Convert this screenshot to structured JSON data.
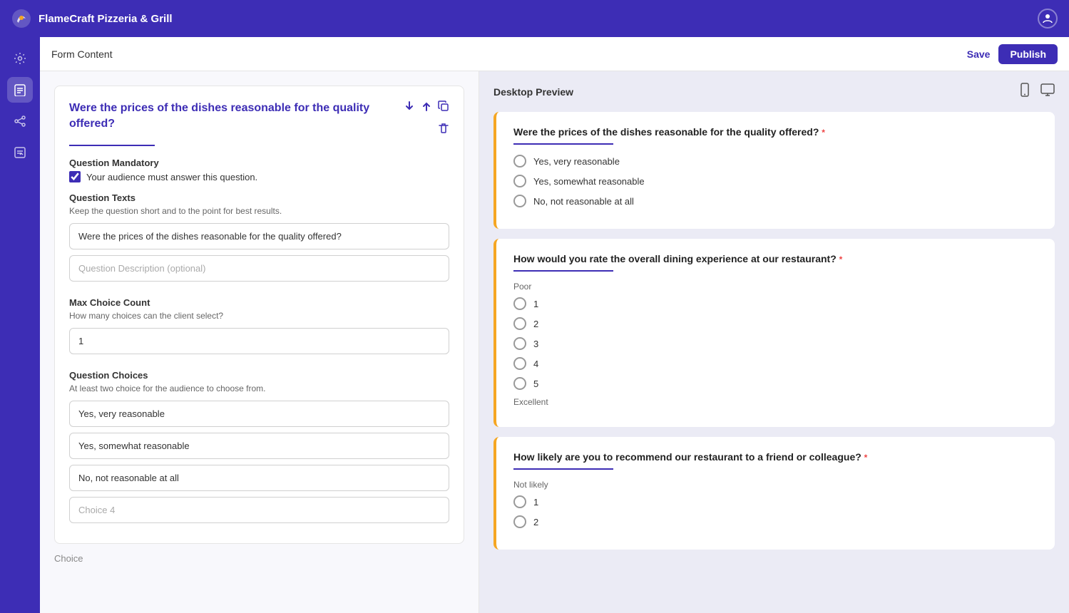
{
  "app": {
    "title": "FlameCraft Pizzeria & Grill"
  },
  "topnav": {
    "title": "FlameCraft Pizzeria & Grill",
    "save_label": "Save",
    "publish_label": "Publish"
  },
  "form_header": {
    "title": "Form Content"
  },
  "preview_header": {
    "title": "Desktop Preview"
  },
  "question": {
    "title": "Were the prices of the dishes reasonable for the quality offered?",
    "mandatory_label": "Question Mandatory",
    "mandatory_desc": "Your audience must answer this question.",
    "mandatory_checked": true,
    "texts_label": "Question Texts",
    "texts_desc": "Keep the question short and to the point for best results.",
    "question_text": "Were the prices of the dishes reasonable for the quality offered?",
    "question_desc_placeholder": "Question Description (optional)",
    "max_choice_label": "Max Choice Count",
    "max_choice_desc": "How many choices can the client select?",
    "max_choice_value": "1",
    "choices_label": "Question Choices",
    "choices_desc": "At least two choice for the audience to choose from.",
    "choices": [
      "Yes, very reasonable",
      "Yes, somewhat reasonable",
      "No, not reasonable at all"
    ],
    "choice4_placeholder": "Choice 4"
  },
  "preview": {
    "q1": {
      "text": "Were the prices of the dishes reasonable for the quality offered?",
      "options": [
        "Yes, very reasonable",
        "Yes, somewhat reasonable",
        "No, not reasonable at all"
      ]
    },
    "q2": {
      "text": "How would you rate the overall dining experience at our restaurant?",
      "scale_low": "Poor",
      "scale_high": "Excellent",
      "options": [
        "1",
        "2",
        "3",
        "4",
        "5"
      ]
    },
    "q3": {
      "text": "How likely are you to recommend our restaurant to a friend or colleague?",
      "scale_low": "Not likely",
      "options": [
        "1",
        "2"
      ]
    }
  },
  "sidebar": {
    "items": [
      {
        "name": "settings",
        "icon": "⚙"
      },
      {
        "name": "forms",
        "icon": "📄"
      },
      {
        "name": "share",
        "icon": "🔗"
      },
      {
        "name": "results",
        "icon": "📋"
      }
    ]
  }
}
